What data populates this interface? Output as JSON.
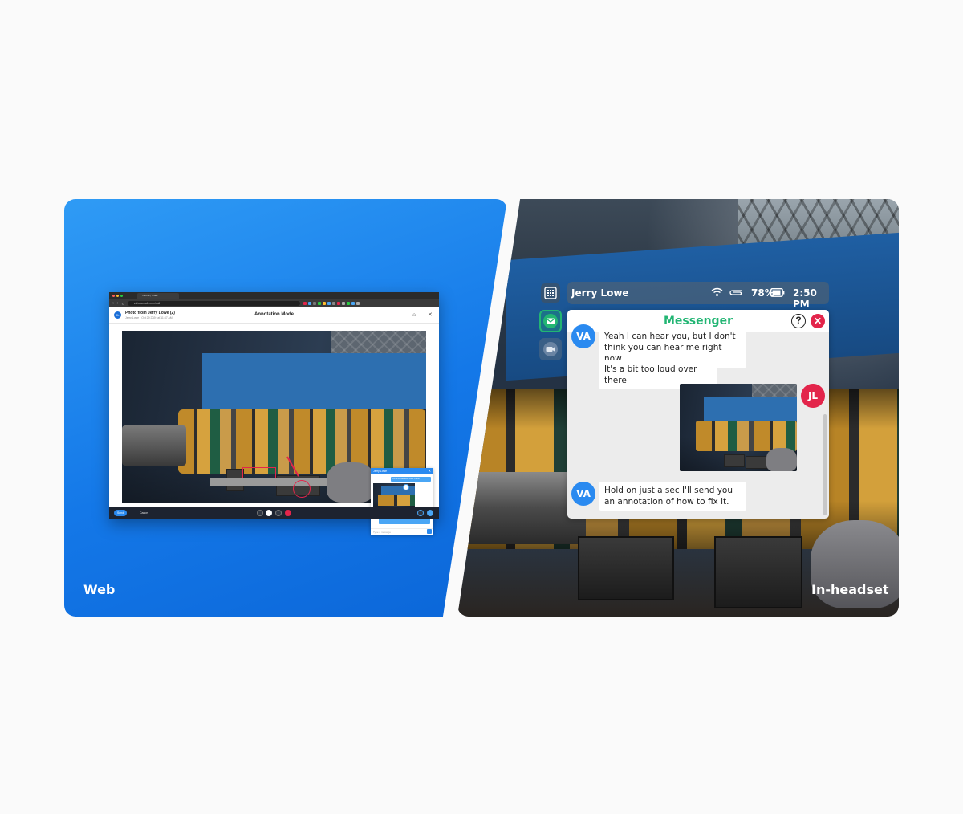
{
  "panels": {
    "web_label": "Web",
    "headset_label": "In-headset"
  },
  "browser": {
    "tab_title": "Vuforia | Chalk",
    "url": "vuforiachalk.com/call",
    "header": {
      "avatar_initials": "JL",
      "photo_title": "Photo from Jerry Lowe (2)",
      "photo_subtitle": "Jerry Lowe · Oct 29 2020 at 11:47 AM",
      "mode_title": "Annotation Mode"
    },
    "chat": {
      "title": "Jerry Lowe",
      "message_1": "It's a bit too loud over there",
      "message_2": "Hold on just a sec I'll send you an annotation of how to fix it.",
      "input_placeholder": "Type a message"
    },
    "footer": {
      "send_label": "Send",
      "cancel_label": "Cancel"
    }
  },
  "headset": {
    "status_bar": {
      "user_name": "Jerry Lowe",
      "battery": "78%",
      "time": "2:50 PM"
    },
    "messenger": {
      "title": "Messenger",
      "messages": [
        {
          "sender": "VA",
          "text": "Yeah I can hear you, but I don't think you can hear me right now"
        },
        {
          "sender": "",
          "text": "It's a bit too loud over there"
        },
        {
          "sender": "JL",
          "text": ""
        },
        {
          "sender": "VA",
          "text": "Hold on just a sec I'll send you an annotation of how to fix it."
        }
      ]
    },
    "colors": {
      "accent_green": "#22b573",
      "va_blue": "#2a8af0",
      "jl_red": "#e3254b"
    }
  }
}
